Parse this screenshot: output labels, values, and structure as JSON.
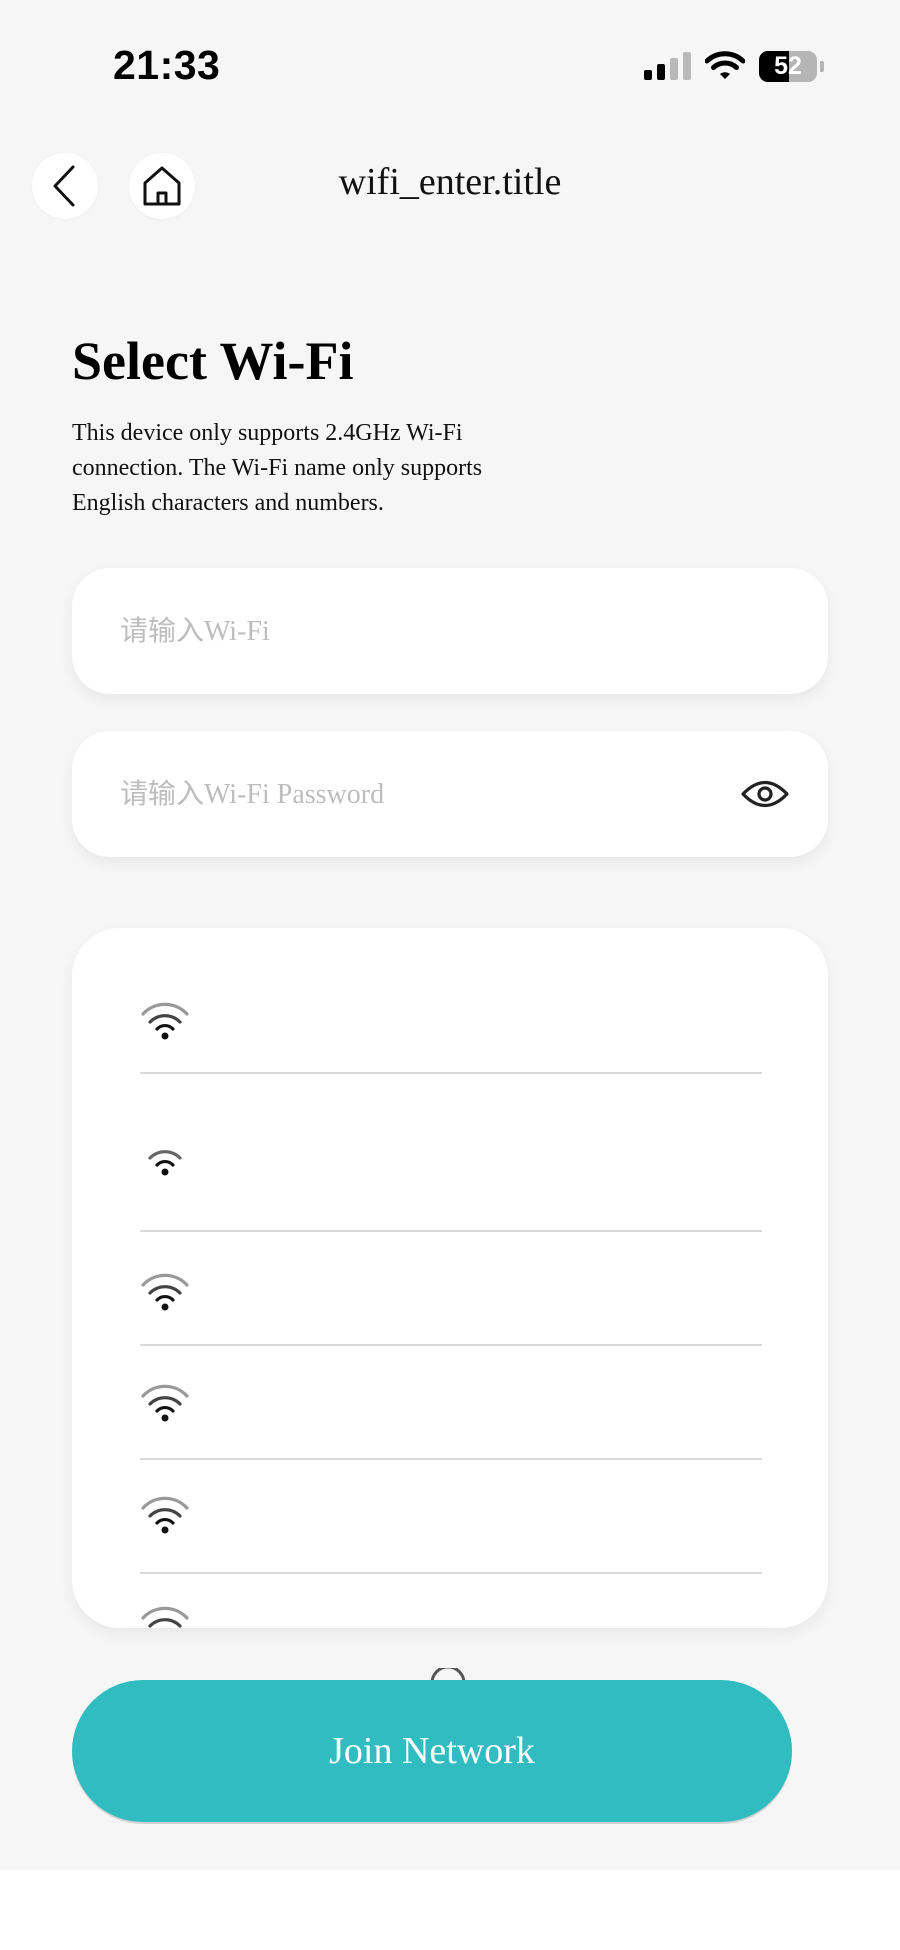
{
  "status_bar": {
    "time": "21:33",
    "battery_level": "52",
    "signal_bars_active": 2,
    "signal_bars_total": 4
  },
  "header": {
    "title": "wifi_enter.title",
    "back_icon": "chevron-left-icon",
    "home_icon": "home-icon"
  },
  "main": {
    "title": "Select Wi-Fi",
    "description": "This device only supports 2.4GHz Wi-Fi connection. The Wi-Fi name only supports English characters and numbers."
  },
  "form": {
    "ssid_placeholder": "请输入Wi-Fi",
    "ssid_value": "",
    "password_placeholder": "请输入Wi-Fi Password",
    "password_value": "",
    "show_password_icon": "eye-icon"
  },
  "wifi_list": [
    {
      "icon": "wifi-icon",
      "name": ""
    },
    {
      "icon": "wifi-icon",
      "name": ""
    },
    {
      "icon": "wifi-icon",
      "name": ""
    },
    {
      "icon": "wifi-icon",
      "name": ""
    },
    {
      "icon": "wifi-icon",
      "name": ""
    },
    {
      "icon": "wifi-icon",
      "name": ""
    }
  ],
  "actions": {
    "join_label": "Join Network"
  },
  "colors": {
    "accent": "#31bcc1",
    "background": "#f6f6f6",
    "card": "#ffffff",
    "placeholder": "#bdbdbd"
  }
}
